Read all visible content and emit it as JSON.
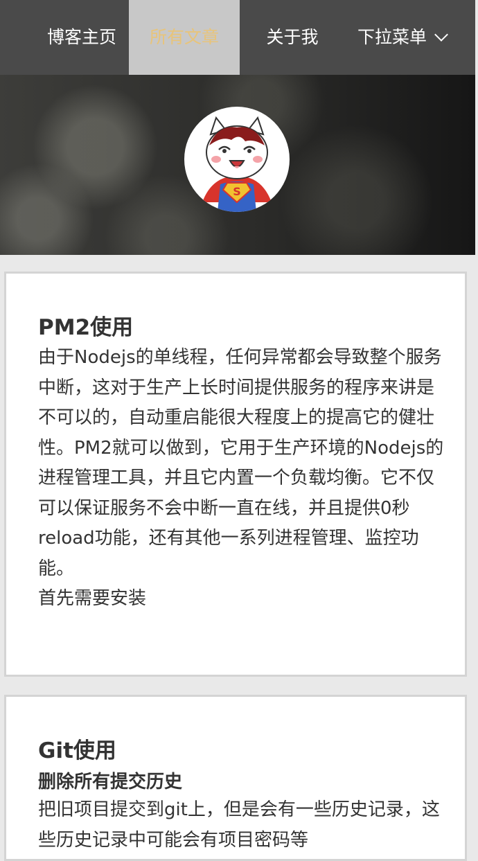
{
  "nav": {
    "items": [
      {
        "label": "博客主页",
        "active": false
      },
      {
        "label": "所有文章",
        "active": true
      },
      {
        "label": "关于我",
        "active": false
      },
      {
        "label": "下拉菜单",
        "active": false
      }
    ],
    "colors": {
      "background": "#4a4a4a",
      "active_background": "#c8c8c8",
      "active_text": "#e8c47a"
    }
  },
  "hero": {
    "avatar_icon": "superman-cat-avatar",
    "avatar_badge": "S"
  },
  "posts": [
    {
      "title": "PM2使用",
      "body": "由于Nodejs的单线程，任何异常都会导致整个服务中断，这对于生产上长时间提供服务的程序来讲是不可以的，自动重启能很大程度上的提高它的健壮性。PM2就可以做到，它用于生产环境的Nodejs的进程管理工具，并且它内置一个负载均衡。它不仅可以保证服务不会中断一直在线，并且提供0秒reload功能，还有其他一系列进程管理、监控功能。",
      "body_tail": "首先需要安装"
    },
    {
      "title": "Git使用",
      "subtitle": "删除所有提交历史",
      "body": "把旧项目提交到git上，但是会有一些历史记录，这些历史记录中可能会有项目密码等"
    }
  ]
}
